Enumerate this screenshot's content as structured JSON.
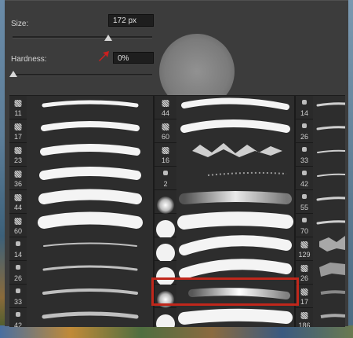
{
  "size": {
    "label": "Size:",
    "value": "172 px"
  },
  "hardness": {
    "label": "Hardness:",
    "value": "0%"
  },
  "colors": {
    "highlight": "#c0271b",
    "arrow": "#cc1f1f",
    "panel": "#3c3c3c"
  },
  "brushes": {
    "col1": [
      "11",
      "17",
      "23",
      "36",
      "44",
      "60",
      "14",
      "26",
      "33",
      "42"
    ],
    "col2": [
      "44",
      "60",
      "16",
      "2",
      "",
      "",
      "",
      "",
      "",
      ""
    ],
    "col3": [
      "14",
      "26",
      "33",
      "42",
      "55",
      "70",
      "129",
      "26",
      "17",
      "186"
    ]
  }
}
